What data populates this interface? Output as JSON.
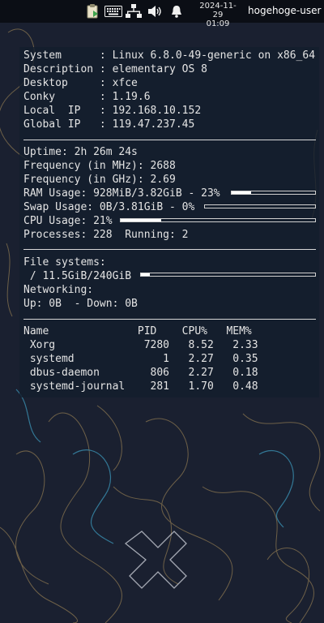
{
  "panel": {
    "tray_icons": [
      "app-updates-icon",
      "keyboard-icon",
      "network-icon",
      "volume-icon",
      "notification-bell-icon"
    ],
    "clock_date": "2024-11-29",
    "clock_time": "01:09",
    "user": "hogehoge-user"
  },
  "conky": {
    "system": [
      {
        "label": "System     ",
        "value": ": Linux 6.8.0-49-generic on x86_64"
      },
      {
        "label": "Description",
        "value": ": elementary OS 8"
      },
      {
        "label": "Desktop    ",
        "value": ": xfce"
      },
      {
        "label": "Conky      ",
        "value": ": 1.19.6"
      },
      {
        "label": "Local  IP  ",
        "value": ": 192.168.10.152"
      },
      {
        "label": "Global IP  ",
        "value": ": 119.47.237.45"
      }
    ],
    "uptime": "Uptime: 2h 26m 24s",
    "freq_mhz": "Frequency (in MHz): 2688",
    "freq_ghz": "Frequency (in GHz): 2.69",
    "ram": {
      "text": "RAM Usage: 928MiB/3.82GiB - 23%",
      "percent": 23
    },
    "swap": {
      "text": "Swap Usage: 0B/3.81GiB - 0%",
      "percent": 0
    },
    "cpu": {
      "text": "CPU Usage: 21%",
      "percent": 21
    },
    "processes": "Processes: 228  Running: 2",
    "fs_label": "File systems:",
    "fs_root": {
      "text": " / 11.5GiB/240GiB",
      "percent": 5
    },
    "net_label": "Networking:",
    "net_updown": "Up: 0B  - Down: 0B",
    "proc_header": "Name              PID    CPU%   MEM%",
    "proc_rows": [
      " Xorg              7280   8.52   2.33",
      " systemd              1   2.27   0.35",
      " dbus-daemon        806   2.27   0.18",
      " systemd-journal    281   1.70   0.48"
    ]
  }
}
